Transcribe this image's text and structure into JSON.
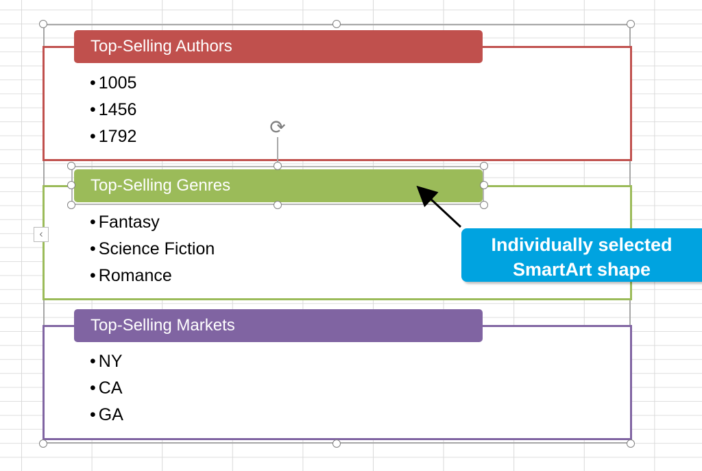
{
  "colors": {
    "authors": "#c0504d",
    "genres": "#9bbb59",
    "markets": "#8064a2",
    "callout": "#00a3e0"
  },
  "sections": [
    {
      "title": "Top-Selling Authors",
      "items": [
        "1005",
        "1456",
        "1792"
      ]
    },
    {
      "title": "Top-Selling Genres",
      "items": [
        "Fantasy",
        "Science Fiction",
        "Romance"
      ]
    },
    {
      "title": "Top-Selling Markets",
      "items": [
        "NY",
        "CA",
        "GA"
      ]
    }
  ],
  "callout": {
    "line1": "Individually selected",
    "line2": "SmartArt shape"
  },
  "icons": {
    "rotate": "rotate-handle-icon",
    "collapse": "chevron-left-icon"
  },
  "glyphs": {
    "rotate": "⟳",
    "collapse": "‹"
  }
}
